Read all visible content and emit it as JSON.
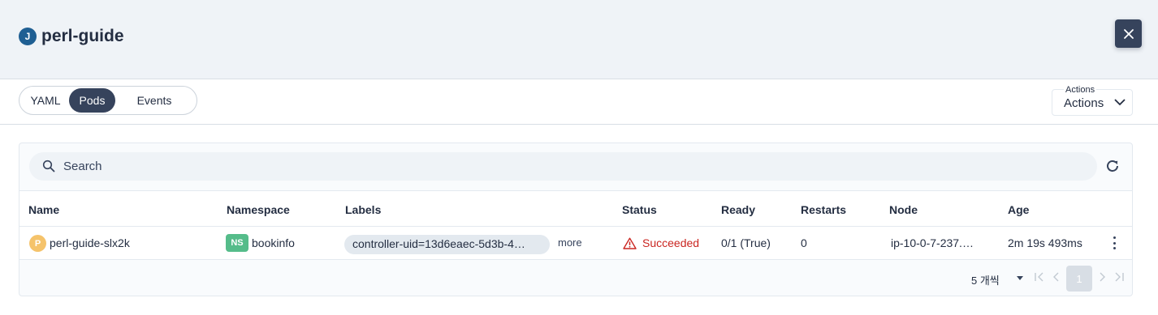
{
  "header": {
    "kind_badge": "J",
    "title": "perl-guide",
    "close_icon": "close-icon"
  },
  "tabs": [
    {
      "label": "YAML",
      "active": false
    },
    {
      "label": "Pods",
      "active": true
    },
    {
      "label": "Events",
      "active": false
    }
  ],
  "actions": {
    "floating_label": "Actions",
    "value": "Actions",
    "icon": "chevron-down-icon"
  },
  "search": {
    "placeholder": "Search",
    "value": "",
    "icon": "search-icon",
    "refresh_icon": "refresh-icon"
  },
  "table": {
    "columns": [
      "Name",
      "Namespace",
      "Labels",
      "Status",
      "Ready",
      "Restarts",
      "Node",
      "Age"
    ],
    "rows": [
      {
        "badge": "P",
        "name": "perl-guide-slx2k",
        "namespace_badge": "NS",
        "namespace": "bookinfo",
        "labels": "controller-uid=13d6eaec-5d3b-4…",
        "more": "more",
        "status": "Succeeded",
        "status_icon": "warning-icon",
        "ready": "0/1 (True)",
        "restarts": "0",
        "node": "ip-10-0-7-237.…",
        "age": "2m 19s 493ms",
        "menu_icon": "more-vertical-icon"
      }
    ]
  },
  "pagination": {
    "page_size": "5 개씩",
    "current_page": "1"
  },
  "colors": {
    "header_bg": "#eff3f7",
    "primary_dark": "#36435c",
    "kind_badge": "#1f5f93",
    "pod_badge": "#f5c36b",
    "ns_badge": "#55bc8a",
    "error": "#ca2621"
  }
}
